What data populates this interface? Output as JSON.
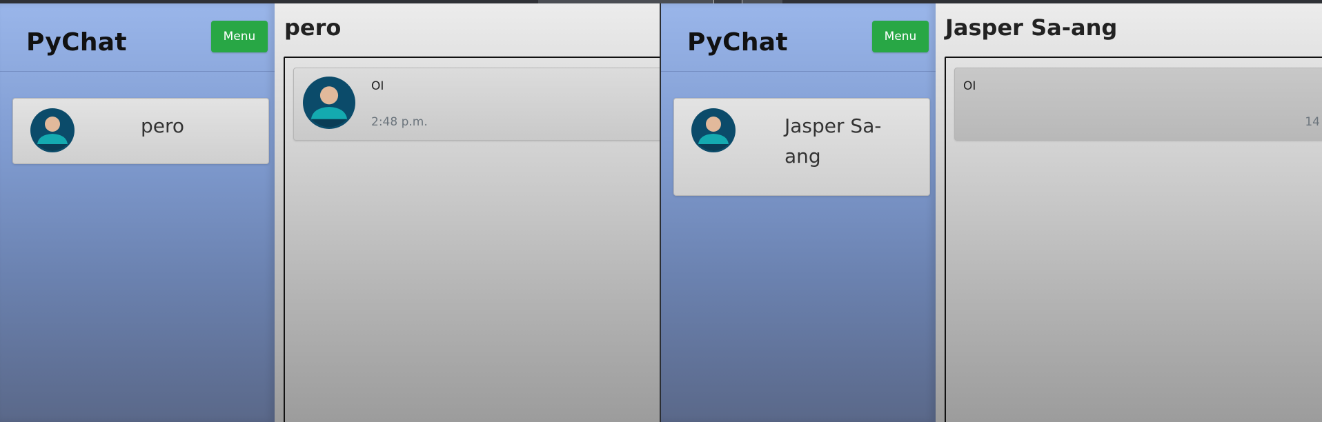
{
  "panes": [
    {
      "app_title": "PyChat",
      "menu_label": "Menu",
      "contact_name": "pero",
      "chat_title": "pero",
      "message": {
        "text": "OI",
        "time": "2:48 p.m."
      }
    },
    {
      "app_title": "PyChat",
      "menu_label": "Menu",
      "contact_name": "Jasper Sa-ang",
      "chat_title": "Jasper Sa-ang",
      "message": {
        "text": "OI",
        "time": "14"
      }
    }
  ],
  "colors": {
    "menu_button": "#28a745",
    "avatar_bg": "#0b4b6a",
    "avatar_body": "#14aab0",
    "avatar_head": "#e2b99b"
  },
  "icons": {
    "avatar": "user-avatar-icon"
  }
}
